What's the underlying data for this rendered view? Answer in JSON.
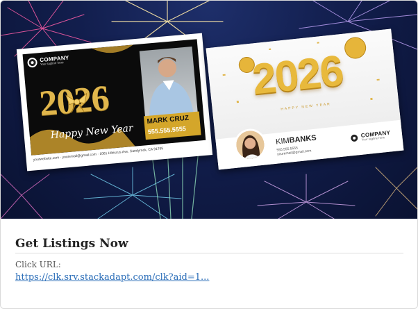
{
  "ad": {
    "title": "Get Listings Now",
    "click_label": "Click URL:",
    "click_url": "https://clk.srv.stackadapt.com/clk?aid=1..."
  },
  "postcard_left": {
    "company": "COMPANY",
    "tagline": "Your tagline here",
    "year": "2026",
    "greeting": "Happy New Year",
    "agent_name": "MARK CRUZ",
    "agent_phone": "555.555.5555",
    "footer": "yourwebsite.com · youremail@gmail.com · 1061 Hibiscus Ave. Sandyrock, CA 91765"
  },
  "postcard_right": {
    "year": "2026",
    "greeting": "HAPPY NEW YEAR",
    "agent_first": "KIM",
    "agent_last": "BANKS",
    "agent_phone": "555.555.5555",
    "agent_email": "youremail@gmail.com",
    "company": "COMPANY",
    "tagline": "Your tagline here"
  },
  "colors": {
    "sky": "#121e4d",
    "gold": "#e0b64c",
    "link": "#2a6db8"
  }
}
